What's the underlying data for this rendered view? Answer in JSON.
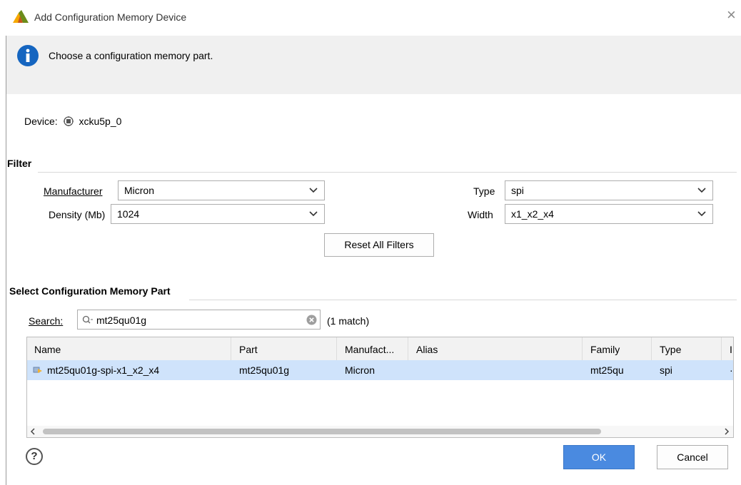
{
  "window": {
    "title": "Add Configuration Memory Device",
    "close_glyph": "×",
    "app_icon": "xilinx-logo-icon"
  },
  "header": {
    "info_icon": "info-icon",
    "message": "Choose a configuration memory part."
  },
  "device": {
    "label": "Device:",
    "chip_icon": "chip-icon",
    "value": "xcku5p_0"
  },
  "filter": {
    "title": "Filter",
    "manufacturer": {
      "label": "Manufacturer",
      "value": "Micron"
    },
    "density": {
      "label": "Density (Mb)",
      "value": "1024"
    },
    "type": {
      "label": "Type",
      "value": "spi"
    },
    "width": {
      "label": "Width",
      "value": "x1_x2_x4"
    },
    "reset_label": "Reset All Filters"
  },
  "select_part": {
    "title": "Select Configuration Memory Part",
    "search_label": "Search:",
    "search_value": "mt25qu01g",
    "match_count": "(1 match)",
    "columns": [
      "Name",
      "Part",
      "Manufact...",
      "Alias",
      "Family",
      "Type",
      "I"
    ],
    "rows": [
      {
        "name": "mt25qu01g-spi-x1_x2_x4",
        "part": "mt25qu01g",
        "manufacturer": "Micron",
        "alias": "",
        "family": "mt25qu",
        "type": "spi",
        "extra": "·"
      }
    ]
  },
  "footer": {
    "help_label": "?",
    "ok_label": "OK",
    "cancel_label": "Cancel"
  },
  "colors": {
    "accent": "#4a8ae0",
    "selected_row": "#cfe3fb",
    "info_blue": "#1565c0"
  }
}
